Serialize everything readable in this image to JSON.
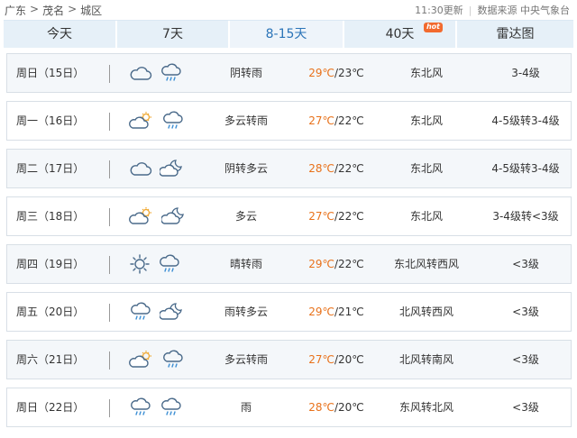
{
  "breadcrumb": {
    "province": "广东",
    "city": "茂名",
    "district": "城区",
    "separator": ">"
  },
  "meta": {
    "update_time": "11:30更新",
    "source": "数据来源 中央气象台"
  },
  "tabs": [
    {
      "label": "今天"
    },
    {
      "label": "7天"
    },
    {
      "label": "8-15天"
    },
    {
      "label": "40天",
      "badge": "hot"
    },
    {
      "label": "雷达图"
    }
  ],
  "colors": {
    "high_temp": "#e8711a",
    "active_tab_text": "#2b74b8",
    "hot_badge": "#f26a2e"
  },
  "forecast": [
    {
      "date": "周日（15日）",
      "icon_day": "cloudy-icon",
      "icon_night": "rain-icon",
      "desc": "阴转雨",
      "high": "29℃",
      "low": "23℃",
      "wind": "东北风",
      "level": "3-4级"
    },
    {
      "date": "周一（16日）",
      "icon_day": "partly-cloudy-icon",
      "icon_night": "rain-icon",
      "desc": "多云转雨",
      "high": "27℃",
      "low": "22℃",
      "wind": "东北风",
      "level": "4-5级转3-4级"
    },
    {
      "date": "周二（17日）",
      "icon_day": "cloudy-icon",
      "icon_night": "partly-cloudy-night-icon",
      "desc": "阴转多云",
      "high": "28℃",
      "low": "22℃",
      "wind": "东北风",
      "level": "4-5级转3-4级"
    },
    {
      "date": "周三（18日）",
      "icon_day": "partly-cloudy-icon",
      "icon_night": "partly-cloudy-night-icon",
      "desc": "多云",
      "high": "27℃",
      "low": "22℃",
      "wind": "东北风",
      "level": "3-4级转<3级"
    },
    {
      "date": "周四（19日）",
      "icon_day": "sunny-icon",
      "icon_night": "rain-icon",
      "desc": "晴转雨",
      "high": "29℃",
      "low": "22℃",
      "wind": "东北风转西风",
      "level": "<3级"
    },
    {
      "date": "周五（20日）",
      "icon_day": "rain-icon",
      "icon_night": "partly-cloudy-night-icon",
      "desc": "雨转多云",
      "high": "29℃",
      "low": "21℃",
      "wind": "北风转西风",
      "level": "<3级"
    },
    {
      "date": "周六（21日）",
      "icon_day": "partly-cloudy-icon",
      "icon_night": "rain-icon",
      "desc": "多云转雨",
      "high": "27℃",
      "low": "20℃",
      "wind": "北风转南风",
      "level": "<3级"
    },
    {
      "date": "周日（22日）",
      "icon_day": "rain-icon",
      "icon_night": "rain-icon",
      "desc": "雨",
      "high": "28℃",
      "low": "20℃",
      "wind": "东风转北风",
      "level": "<3级"
    }
  ]
}
